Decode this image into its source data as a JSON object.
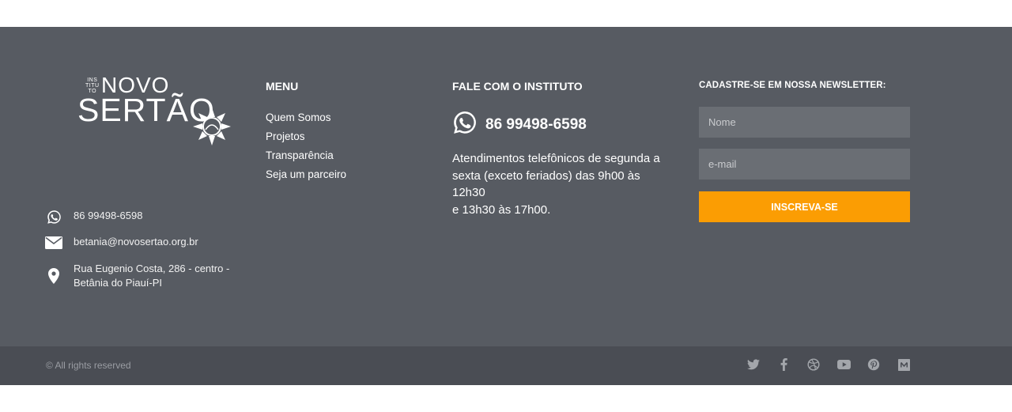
{
  "logo": {
    "small_text_lines": [
      "INS",
      "TITU",
      "TO"
    ],
    "top_word": "NOVO",
    "main_word": "SERTÃO"
  },
  "contact": {
    "phone": "86 99498-6598",
    "email": "betania@novosertao.org.br",
    "address": "Rua Eugenio Costa, 286 - centro - Betânia do Piauí-PI"
  },
  "menu": {
    "title": "MENU",
    "items": [
      {
        "label": "Quem Somos"
      },
      {
        "label": "Projetos"
      },
      {
        "label": "Transparência"
      },
      {
        "label": "Seja um parceiro"
      }
    ]
  },
  "fale": {
    "title": "FALE COM O INSTITUTO",
    "phone": "86 99498-6598",
    "hours_line1": "Atendimentos telefônicos de segunda a sexta (exceto feriados) das 9h00 às 12h30",
    "hours_line2": "e 13h30 às 17h00."
  },
  "newsletter": {
    "title": "CADASTRE-SE EM NOSSA NEWSLETTER:",
    "name_placeholder": "Nome",
    "email_placeholder": "e-mail",
    "button_label": "INSCREVA-SE"
  },
  "bottom": {
    "rights": "© All rights reserved",
    "socials": [
      "twitter-icon",
      "facebook-icon",
      "dribbble-icon",
      "youtube-icon",
      "pinterest-icon",
      "medium-icon"
    ]
  },
  "colors": {
    "footer_bg": "#575b62",
    "bottom_bg": "#4a4d54",
    "accent": "#fb9d03"
  }
}
